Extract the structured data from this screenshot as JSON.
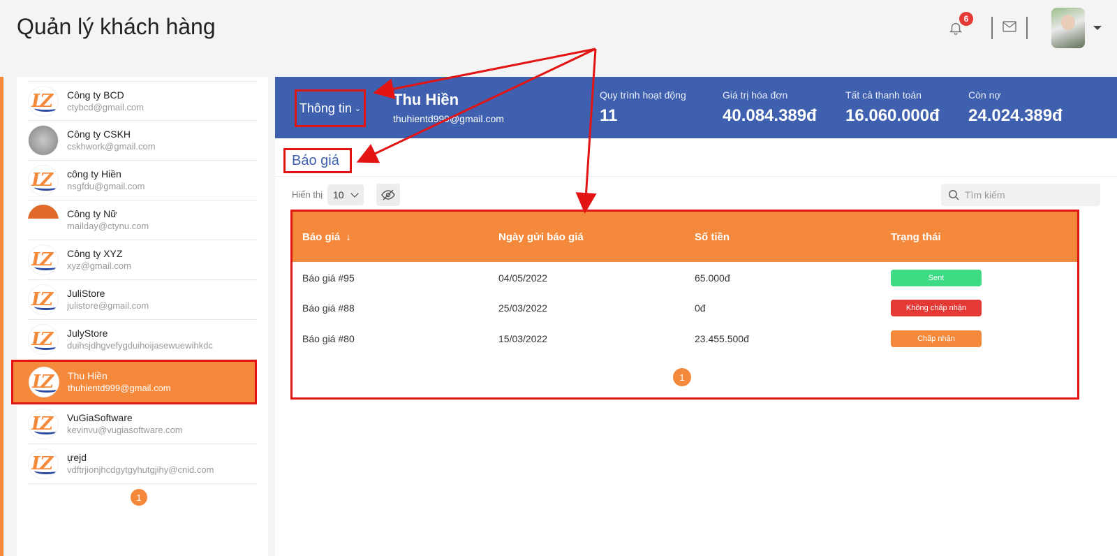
{
  "header": {
    "title": "Quản lý khách hàng",
    "notification_count": "6",
    "colors": {
      "accent": "#f5893b",
      "banner": "#3f60ae",
      "highlight": "#e31414"
    }
  },
  "sidebar": {
    "customers": [
      {
        "name": "Công ty BCD",
        "email": "ctybcd@gmail.com",
        "logo": "lz-logo"
      },
      {
        "name": "Công ty CSKH",
        "email": "cskhwork@gmail.com",
        "logo": "photo"
      },
      {
        "name": "công ty Hiền",
        "email": "nsgfdu@gmail.com",
        "logo": "lz-logo"
      },
      {
        "name": "Công ty Nữ",
        "email": "mailday@ctynu.com",
        "logo": "half"
      },
      {
        "name": "Công ty XYZ",
        "email": "xyz@gmail.com",
        "logo": "lz-logo"
      },
      {
        "name": "JuliStore",
        "email": "julistore@gmail.com",
        "logo": "lz-logo"
      },
      {
        "name": "JulyStore",
        "email": "duihsjdhgvefygduihoijasewuewihkdc",
        "logo": "lz-logo"
      },
      {
        "name": "Thu Hiền",
        "email": "thuhientd999@gmail.com",
        "logo": "lz-logo",
        "active": true
      },
      {
        "name": "VuGiaSoftware",
        "email": "kevinvu@vugiasoftware.com",
        "logo": "lz-logo"
      },
      {
        "name": "ựejd",
        "email": "vdftrjionjhcdgytgyhutgjihy@cnid.com",
        "logo": "lz-logo"
      }
    ],
    "page": "1"
  },
  "banner": {
    "info_dropdown": "Thông tin",
    "customer_name": "Thu Hiền",
    "customer_email": "thuhientd999@gmail.com",
    "stats": [
      {
        "label": "Quy trình hoạt động",
        "value": "11"
      },
      {
        "label": "Giá trị hóa đơn",
        "value": "40.084.389đ"
      },
      {
        "label": "Tất cả thanh toán",
        "value": "16.060.000đ"
      },
      {
        "label": "Còn nợ",
        "value": "24.024.389đ"
      }
    ]
  },
  "quotes": {
    "section_title": "Báo giá",
    "show_label": "Hiển thị",
    "page_size": "10",
    "search_placeholder": "Tìm kiếm",
    "columns": [
      "Báo giá",
      "Ngày gửi báo giá",
      "Số tiền",
      "Trạng thái"
    ],
    "sort_arrow": "↓",
    "rows": [
      {
        "id": "Báo giá #95",
        "date": "04/05/2022",
        "amount": "65.000đ",
        "status": "Sent",
        "status_color": "#3ddc84"
      },
      {
        "id": "Báo giá #88",
        "date": "25/03/2022",
        "amount": "0đ",
        "status": "Không chấp nhận",
        "status_color": "#e53935"
      },
      {
        "id": "Báo giá #80",
        "date": "15/03/2022",
        "amount": "23.455.500đ",
        "status": "Chấp nhận",
        "status_color": "#f5893b"
      }
    ],
    "page": "1"
  }
}
